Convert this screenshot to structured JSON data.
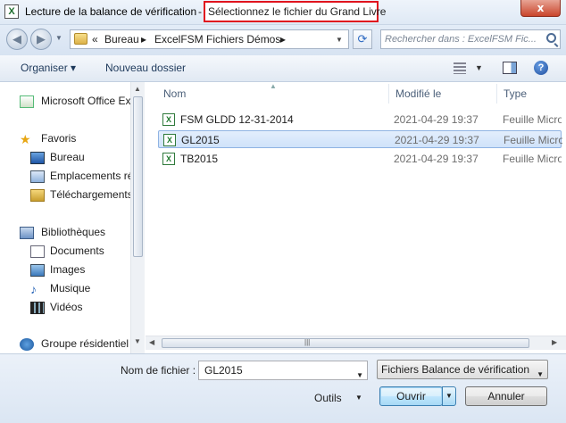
{
  "window": {
    "title": "Lecture de la balance de vérification",
    "separator": "-",
    "subtitle": "Sélectionnez le fichier du Grand Livre",
    "close_label": "x",
    "icon": "excel-icon"
  },
  "address": {
    "overflow": "«",
    "crumbs": [
      "Bureau",
      "ExcelFSM Fichiers Démos"
    ],
    "search_placeholder": "Rechercher dans : ExcelFSM Fic..."
  },
  "toolbar": {
    "organize_label": "Organiser ▾",
    "new_folder_label": "Nouveau dossier"
  },
  "nav": {
    "items": [
      {
        "label": "Microsoft Office Ex",
        "icon": "office-icon"
      },
      {
        "label": "Favoris",
        "icon": "star-icon"
      },
      {
        "label": "Bureau",
        "icon": "desktop-icon"
      },
      {
        "label": "Emplacements ré",
        "icon": "places-icon"
      },
      {
        "label": "Téléchargements",
        "icon": "downloads-icon"
      },
      {
        "label": "Bibliothèques",
        "icon": "library-icon"
      },
      {
        "label": "Documents",
        "icon": "documents-icon"
      },
      {
        "label": "Images",
        "icon": "images-icon"
      },
      {
        "label": "Musique",
        "icon": "music-icon"
      },
      {
        "label": "Vidéos",
        "icon": "videos-icon"
      },
      {
        "label": "Groupe résidentiel",
        "icon": "homegroup-icon"
      }
    ]
  },
  "files": {
    "columns": [
      "Nom",
      "Modifié le",
      "Type"
    ],
    "rows": [
      {
        "name": "FSM GLDD 12-31-2014",
        "date": "2021-04-29 19:37",
        "type": "Feuille Micro"
      },
      {
        "name": "GL2015",
        "date": "2021-04-29 19:37",
        "type": "Feuille Micro",
        "selected": true
      },
      {
        "name": "TB2015",
        "date": "2021-04-29 19:37",
        "type": "Feuille Micro"
      }
    ]
  },
  "footer": {
    "filename_label": "Nom de fichier :",
    "filename_value": "GL2015",
    "filter_value": "Fichiers Balance de vérification",
    "tools_label": "Outils",
    "open_label": "Ouvrir",
    "cancel_label": "Annuler"
  },
  "colors": {
    "highlight_border": "#e0141e",
    "selection_bg": "#cfe2fa",
    "close_red": "#c9452b"
  }
}
